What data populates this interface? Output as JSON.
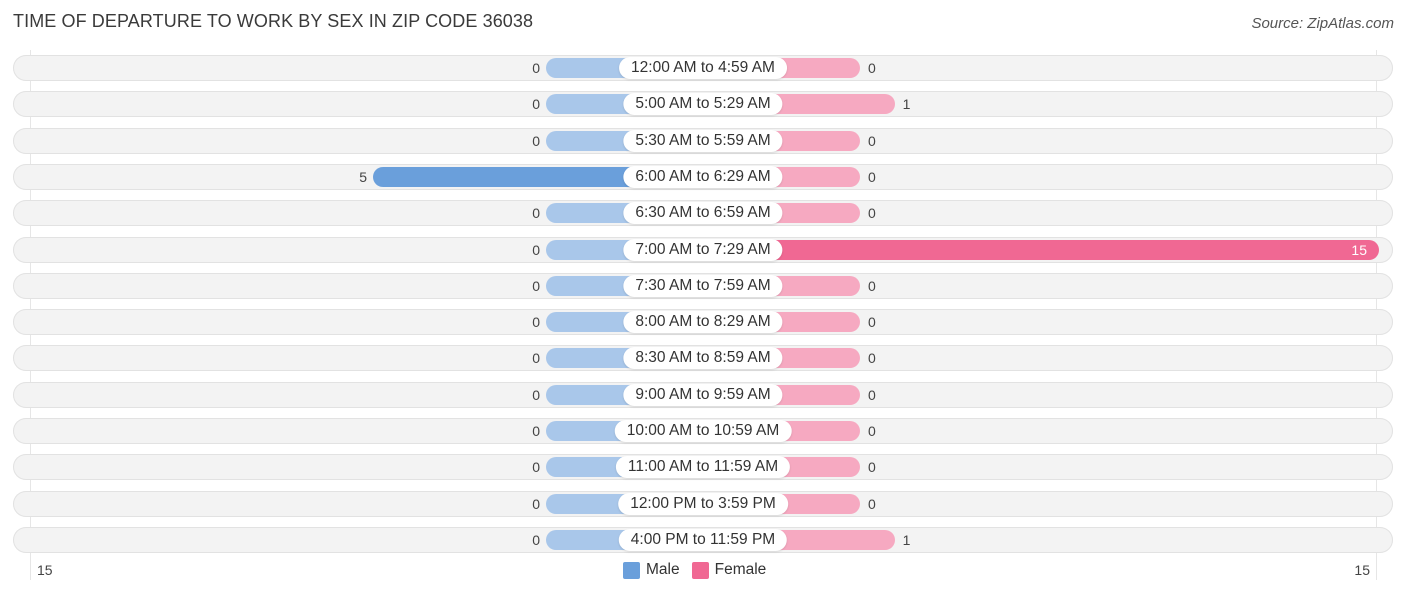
{
  "header": {
    "title": "TIME OF DEPARTURE TO WORK BY SEX IN ZIP CODE 36038",
    "source": "Source: ZipAtlas.com"
  },
  "colors": {
    "male_light": "#a9c7ea",
    "male_strong": "#6a9fdb",
    "female_light": "#f6a9c1",
    "female_strong": "#f06893",
    "row_bg": "#f3f3f3"
  },
  "chart_data": {
    "type": "bar",
    "orientation": "horizontal-diverging",
    "title": "TIME OF DEPARTURE TO WORK BY SEX IN ZIP CODE 36038",
    "categories": [
      "12:00 AM to 4:59 AM",
      "5:00 AM to 5:29 AM",
      "5:30 AM to 5:59 AM",
      "6:00 AM to 6:29 AM",
      "6:30 AM to 6:59 AM",
      "7:00 AM to 7:29 AM",
      "7:30 AM to 7:59 AM",
      "8:00 AM to 8:29 AM",
      "8:30 AM to 8:59 AM",
      "9:00 AM to 9:59 AM",
      "10:00 AM to 10:59 AM",
      "11:00 AM to 11:59 AM",
      "12:00 PM to 3:59 PM",
      "4:00 PM to 11:59 PM"
    ],
    "series": [
      {
        "name": "Male",
        "values": [
          0,
          0,
          0,
          5,
          0,
          0,
          0,
          0,
          0,
          0,
          0,
          0,
          0,
          0
        ]
      },
      {
        "name": "Female",
        "values": [
          0,
          1,
          0,
          0,
          0,
          15,
          0,
          0,
          0,
          0,
          0,
          0,
          0,
          1
        ]
      }
    ],
    "axis": {
      "left_tick": "15",
      "right_tick": "15",
      "range": [
        -15,
        15
      ]
    },
    "legend": {
      "position": "bottom-center",
      "entries": [
        "Male",
        "Female"
      ]
    },
    "grid": false
  }
}
